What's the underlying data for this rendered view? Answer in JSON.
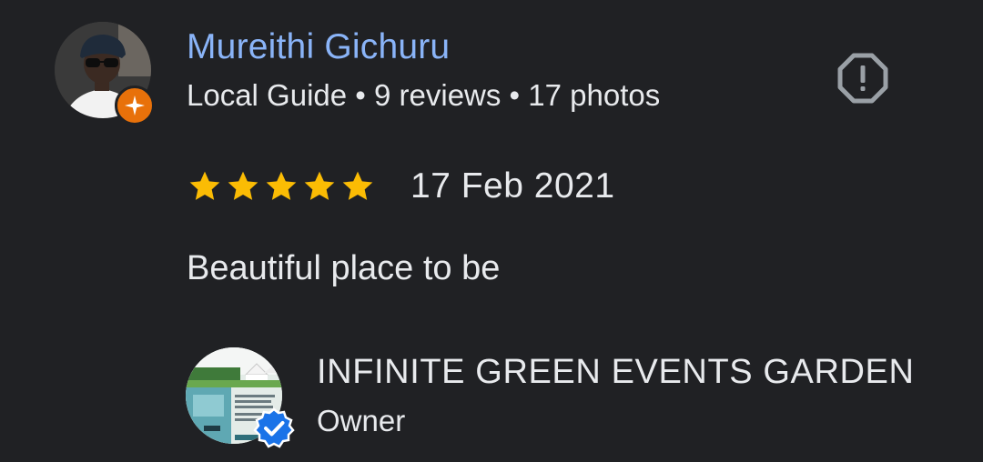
{
  "review": {
    "reviewer": {
      "name": "Mureithi Gichuru",
      "meta": "Local Guide • 9 reviews • 17 photos",
      "avatar_icon": "person-photo",
      "badge_icon": "local-guide-star-icon",
      "badge_color": "#e8710a"
    },
    "report_icon": "report-octagon-icon",
    "rating": {
      "stars": 5,
      "max": 5,
      "color": "#fbbc04"
    },
    "date": "17 Feb 2021",
    "text": "Beautiful place to be"
  },
  "owner": {
    "name": "INFINITE GREEN EVENTS GARDEN",
    "role": "Owner",
    "avatar_icon": "venue-poster-photo",
    "verified_icon": "verified-check-icon",
    "verified_color": "#1a73e8"
  },
  "colors": {
    "background": "#202124",
    "name_link": "#8ab4f8",
    "text": "#e8eaed"
  }
}
